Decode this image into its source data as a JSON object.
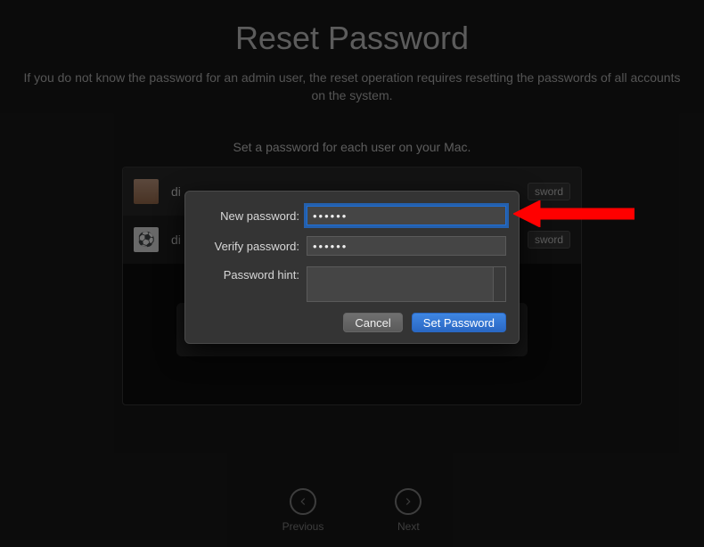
{
  "header": {
    "title": "Reset Password",
    "subtitle": "If you do not know the password for an admin user, the reset operation requires resetting the passwords of all accounts on the system.",
    "prompt": "Set a password for each user on your Mac."
  },
  "users": [
    {
      "avatar_icon": "face",
      "name_visible": "di",
      "button_label_visible": "sword"
    },
    {
      "avatar_icon": "ball",
      "name_visible": "di",
      "button_label_visible": "sword"
    }
  ],
  "modal": {
    "new_password_label": "New password:",
    "new_password_value": "••••••",
    "verify_password_label": "Verify password:",
    "verify_password_value": "••••••",
    "hint_label": "Password hint:",
    "hint_value": "",
    "cancel_label": "Cancel",
    "submit_label": "Set Password"
  },
  "nav": {
    "previous": "Previous",
    "next": "Next"
  },
  "annotation": {
    "arrow_color": "#ff0000"
  }
}
